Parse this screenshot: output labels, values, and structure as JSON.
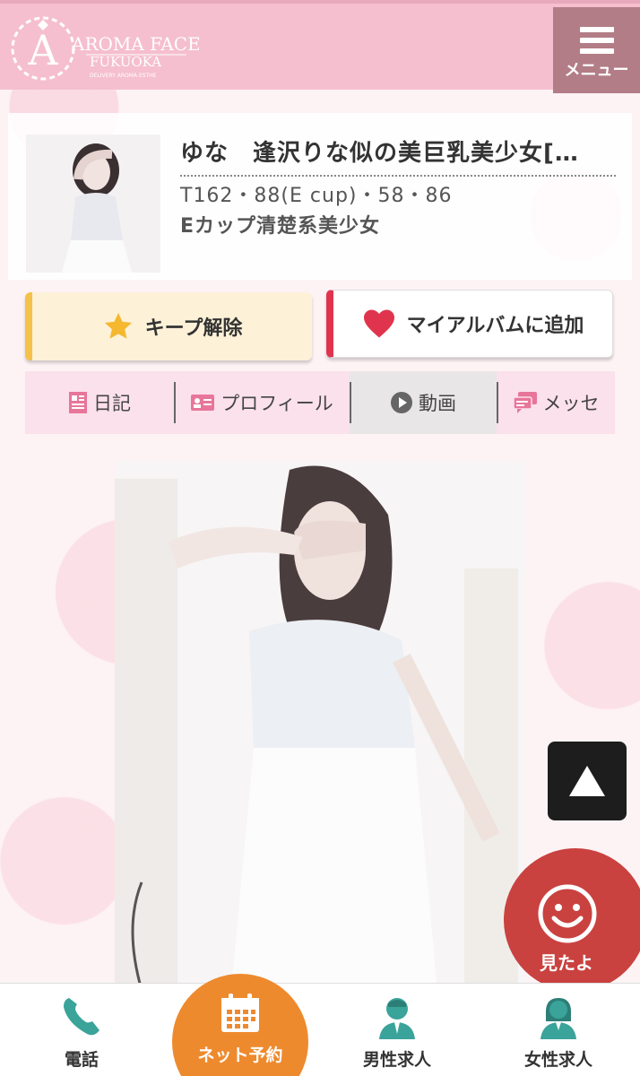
{
  "header": {
    "logo_letter": "A",
    "logo_title": "AROMA FACE",
    "logo_subtitle": "FUKUOKA",
    "logo_tagline": "DELIVERY AROMA ESTHE",
    "menu_label": "メニュー"
  },
  "profile": {
    "name": "ゆな　逢沢りな似の美巨乳美少女[…",
    "stats": "T162・88(E cup)・58・86",
    "catchphrase": "Eカップ清楚系美少女"
  },
  "actions": {
    "keep_label": "キープ解除",
    "album_label": "マイアルバムに追加"
  },
  "tabs": [
    {
      "label": "日記",
      "icon": "diary-icon"
    },
    {
      "label": "プロフィール",
      "icon": "profile-card-icon"
    },
    {
      "label": "動画",
      "icon": "play-icon"
    },
    {
      "label": "メッセ",
      "icon": "message-icon"
    }
  ],
  "floating": {
    "mitayo_label": "見たよ"
  },
  "footer": {
    "phone_label": "電話",
    "reserve_label": "ネット予約",
    "male_jobs_label": "男性求人",
    "female_jobs_label": "女性求人"
  },
  "colors": {
    "header_bg": "#f5bfd0",
    "menu_bg": "#b27d86",
    "keep_accent": "#f6c14a",
    "album_accent": "#e0344e",
    "tab_bg": "#fbe1eb",
    "mitayo_bg": "#c9423f",
    "reserve_bg": "#ee8a2e",
    "icon_teal": "#3aa39a"
  }
}
